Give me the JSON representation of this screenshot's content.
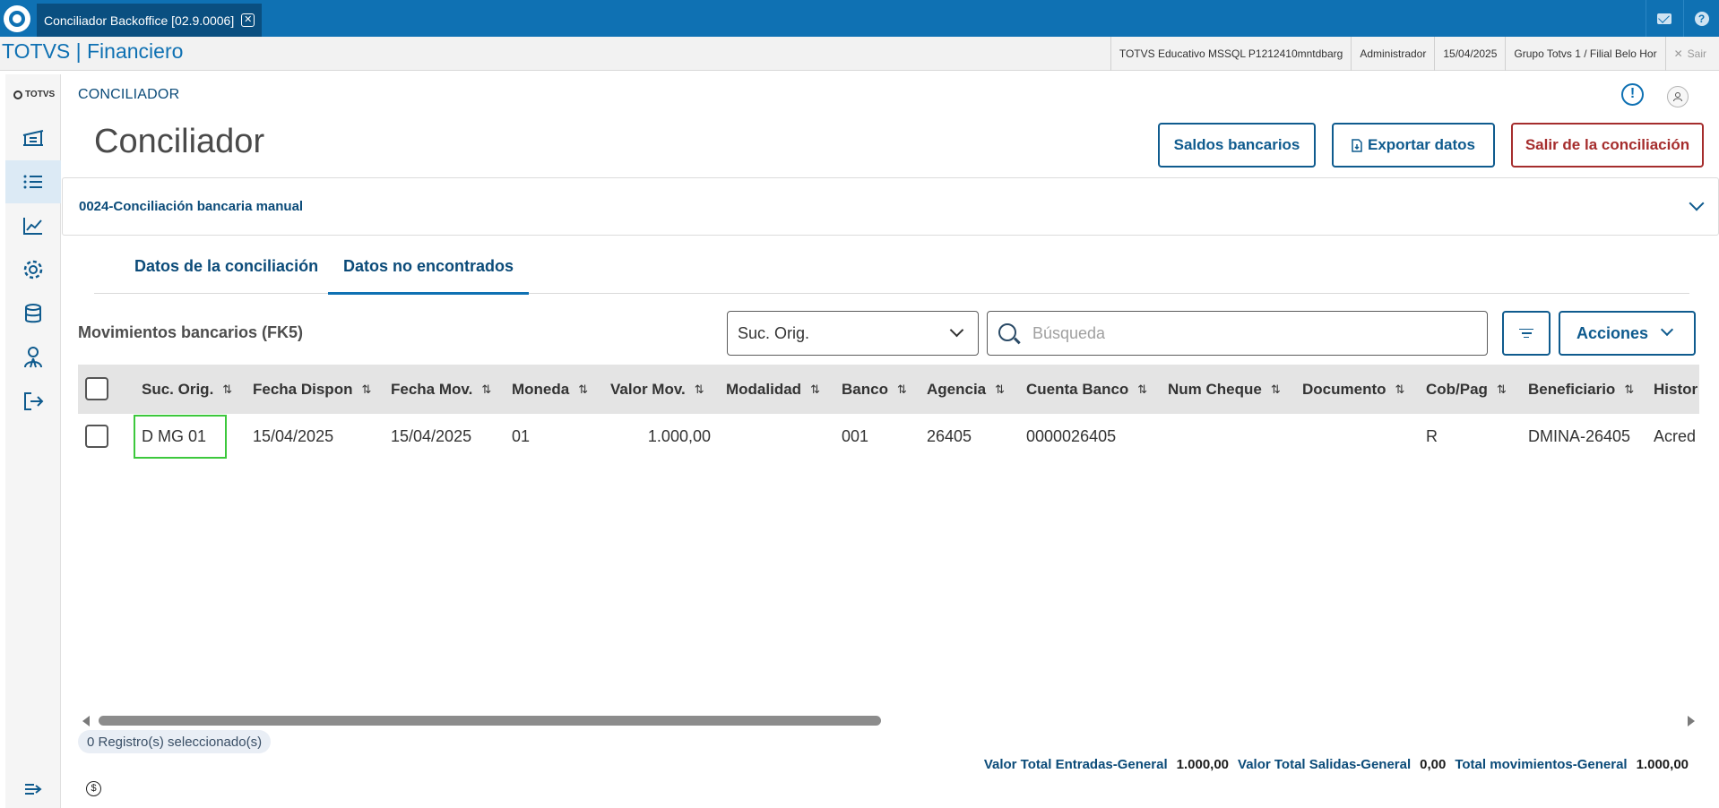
{
  "window": {
    "tab_title": "Conciliador Backoffice [02.9.0006]",
    "brand": "TOTVS | Financiero"
  },
  "session": {
    "environment": "TOTVS Educativo MSSQL P1212410mntdbarg",
    "user": "Administrador",
    "date": "15/04/2025",
    "branch": "Grupo Totvs 1 / Filial Belo Hor",
    "logout": "Sair"
  },
  "rail": {
    "logo": "TOTVS",
    "items": [
      "building-icon",
      "list-icon",
      "chart-icon",
      "gear-icon",
      "database-icon",
      "person-icon",
      "exit-icon"
    ],
    "collapse_icon": "collapse-menu-icon"
  },
  "header": {
    "breadcrumb": "CONCILIADOR",
    "title": "Conciliador",
    "buttons": {
      "saldos": "Saldos bancarios",
      "exportar": "Exportar datos",
      "salir": "Salir de la conciliación"
    }
  },
  "panel": {
    "title": "0024-Conciliación bancaria manual"
  },
  "tabs": [
    {
      "label": "Datos de la conciliación",
      "active": false
    },
    {
      "label": "Datos no encontrados",
      "active": true
    }
  ],
  "toolbar": {
    "section_label": "Movimientos bancarios (FK5)",
    "select_value": "Suc. Orig.",
    "search_placeholder": "Búsqueda",
    "actions_label": "Acciones"
  },
  "table": {
    "columns": [
      "Suc. Orig.",
      "Fecha Dispon",
      "Fecha Mov.",
      "Moneda",
      "Valor Mov.",
      "Modalidad",
      "Banco",
      "Agencia",
      "Cuenta Banco",
      "Num Cheque",
      "Documento",
      "Cob/Pag",
      "Beneficiario",
      "Histor"
    ],
    "rows": [
      [
        "D MG 01",
        "15/04/2025",
        "15/04/2025",
        "01",
        "1.000,00",
        "",
        "001",
        "26405",
        "0000026405",
        "",
        "",
        "R",
        "DMINA-26405",
        "Acred"
      ]
    ],
    "sort_glyph": "⇅"
  },
  "footer": {
    "selected": "0 Registro(s) seleccionado(s)",
    "totals": [
      {
        "label": "Valor Total Entradas-General",
        "value": "1.000,00"
      },
      {
        "label": "Valor Total Salidas-General",
        "value": "0,00"
      },
      {
        "label": "Total movimientos-General",
        "value": "1.000,00"
      }
    ]
  },
  "colors": {
    "primary": "#0f71b3",
    "dark_blue": "#0b4b79",
    "danger": "#a52d2d",
    "highlight": "#3cc83c"
  }
}
